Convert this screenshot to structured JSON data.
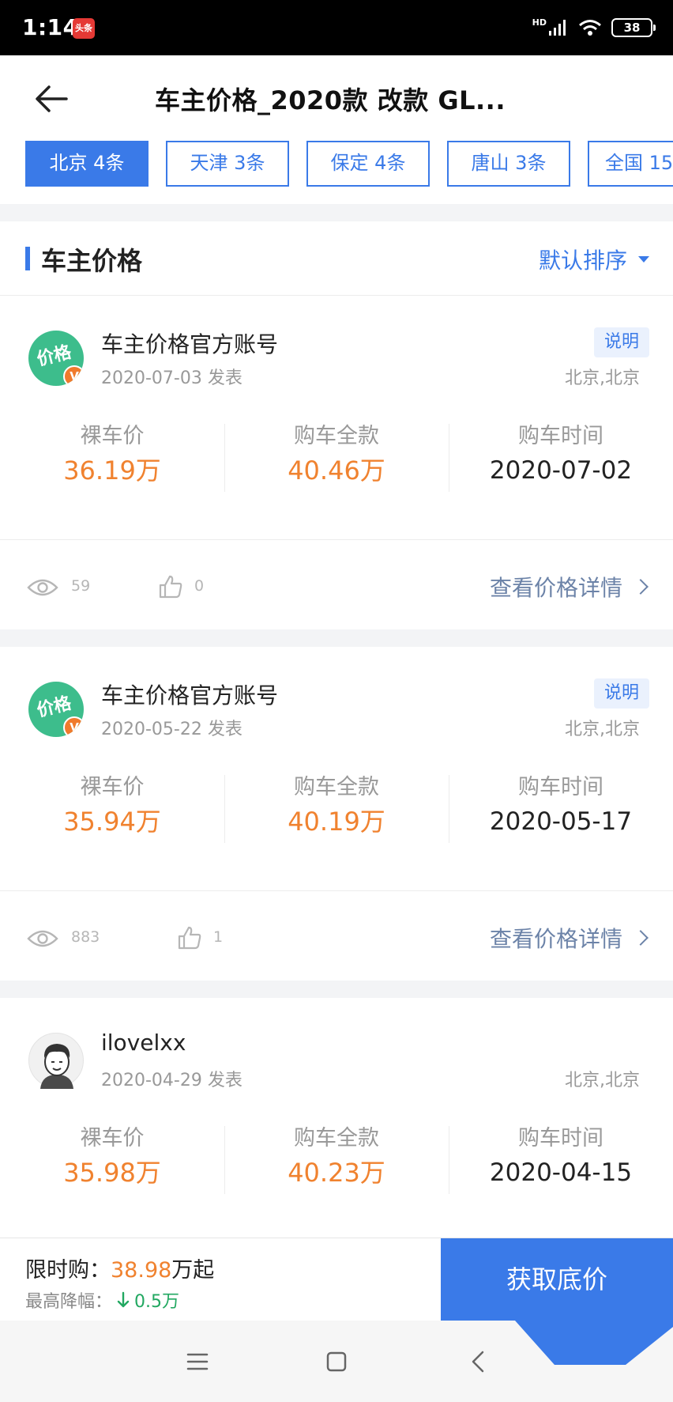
{
  "status_bar": {
    "time": "1:14",
    "app_badge": "头条",
    "network": "HD",
    "battery": "38"
  },
  "header": {
    "title": "车主价格_2020款 改款 GL..."
  },
  "city_tabs": [
    {
      "label": "北京 4条",
      "active": true
    },
    {
      "label": "天津 3条",
      "active": false
    },
    {
      "label": "保定 4条",
      "active": false
    },
    {
      "label": "唐山 3条",
      "active": false
    },
    {
      "label": "全国 15",
      "active": false
    }
  ],
  "section": {
    "title": "车主价格",
    "sort_label": "默认排序"
  },
  "labels": {
    "bare_price": "裸车价",
    "total_price": "购车全款",
    "purchase_time": "购车时间",
    "note": "说明",
    "view_details": "查看价格详情"
  },
  "posts": [
    {
      "user": "车主价格官方账号",
      "avatar_icon": "official-account-avatar",
      "avatar_text": "价格",
      "date": "2020-07-03 发表",
      "location": "北京,北京",
      "has_note": true,
      "bare_price": "36.19万",
      "total_price": "40.46万",
      "purchase_date": "2020-07-02",
      "views": "59",
      "likes": "0"
    },
    {
      "user": "车主价格官方账号",
      "avatar_icon": "official-account-avatar",
      "avatar_text": "价格",
      "date": "2020-05-22 发表",
      "location": "北京,北京",
      "has_note": true,
      "bare_price": "35.94万",
      "total_price": "40.19万",
      "purchase_date": "2020-05-17",
      "views": "883",
      "likes": "1"
    },
    {
      "user": "ilovelxx",
      "avatar_icon": "cartoon-user-avatar",
      "date": "2020-04-29 发表",
      "location": "北京,北京",
      "has_note": false,
      "bare_price": "35.98万",
      "total_price": "40.23万",
      "purchase_date": "2020-04-15"
    }
  ],
  "bottom_bar": {
    "promo_label": "限时购：",
    "promo_price": "38.98",
    "promo_suffix": "万起",
    "drop_label": "最高降幅：",
    "drop_value": "0.5万",
    "cta": "获取底价"
  },
  "colors": {
    "accent": "#3a7ae8",
    "price": "#f0822f",
    "drop": "#22a861"
  }
}
